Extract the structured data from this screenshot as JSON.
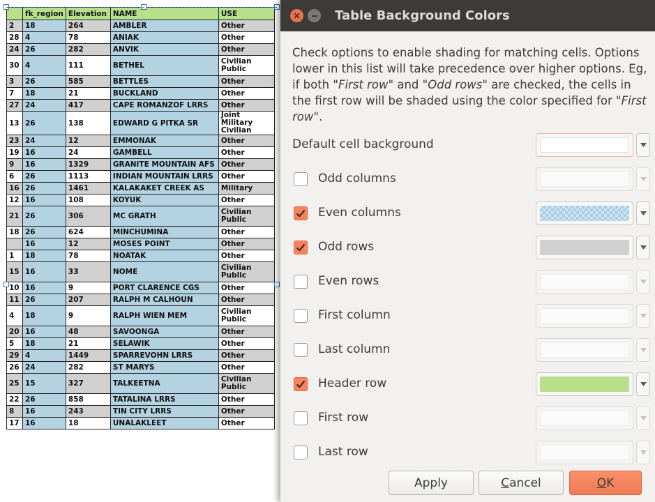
{
  "table": {
    "headers": [
      "",
      "fk_region",
      "Elevation",
      "NAME",
      "USE"
    ],
    "rows": [
      {
        "id": "2",
        "region": "18",
        "elev": "264",
        "name": "AMBLER",
        "use": "Other",
        "tall": false
      },
      {
        "id": "28",
        "region": "4",
        "elev": "78",
        "name": "ANIAK",
        "use": "Other",
        "tall": false
      },
      {
        "id": "24",
        "region": "26",
        "elev": "282",
        "name": "ANVIK",
        "use": "Other",
        "tall": false
      },
      {
        "id": "30",
        "region": "4",
        "elev": "111",
        "name": "BETHEL",
        "use": "Civilian Public",
        "tall": true
      },
      {
        "id": "3",
        "region": "26",
        "elev": "585",
        "name": "BETTLES",
        "use": "Other",
        "tall": false
      },
      {
        "id": "7",
        "region": "18",
        "elev": "21",
        "name": "BUCKLAND",
        "use": "Other",
        "tall": false
      },
      {
        "id": "27",
        "region": "24",
        "elev": "417",
        "name": "CAPE ROMANZOF LRRS",
        "use": "Other",
        "tall": false
      },
      {
        "id": "13",
        "region": "26",
        "elev": "138",
        "name": "EDWARD G PITKA SR",
        "use": "Joint Military Civilian",
        "tall": true
      },
      {
        "id": "23",
        "region": "24",
        "elev": "12",
        "name": "EMMONAK",
        "use": "Other",
        "tall": false
      },
      {
        "id": "19",
        "region": "16",
        "elev": "24",
        "name": "GAMBELL",
        "use": "Other",
        "tall": false
      },
      {
        "id": "9",
        "region": "16",
        "elev": "1329",
        "name": "GRANITE MOUNTAIN AFS",
        "use": "Other",
        "tall": false
      },
      {
        "id": "6",
        "region": "26",
        "elev": "1113",
        "name": "INDIAN MOUNTAIN LRRS",
        "use": "Other",
        "tall": false
      },
      {
        "id": "16",
        "region": "26",
        "elev": "1461",
        "name": "KALAKAKET CREEK AS",
        "use": "Military",
        "tall": false
      },
      {
        "id": "12",
        "region": "16",
        "elev": "108",
        "name": "KOYUK",
        "use": "Other",
        "tall": false
      },
      {
        "id": "21",
        "region": "26",
        "elev": "306",
        "name": "MC GRATH",
        "use": "Civilian Public",
        "tall": true
      },
      {
        "id": "18",
        "region": "26",
        "elev": "624",
        "name": "MINCHUMINA",
        "use": "Other",
        "tall": false
      },
      {
        "id": "",
        "region": "16",
        "elev": "12",
        "name": "MOSES POINT",
        "use": "Other",
        "tall": false
      },
      {
        "id": "1",
        "region": "18",
        "elev": "78",
        "name": "NOATAK",
        "use": "Other",
        "tall": false
      },
      {
        "id": "15",
        "region": "16",
        "elev": "33",
        "name": "NOME",
        "use": "Civilian Public",
        "tall": true
      },
      {
        "id": "10",
        "region": "16",
        "elev": "9",
        "name": "PORT CLARENCE CGS",
        "use": "Other",
        "tall": false
      },
      {
        "id": "11",
        "region": "26",
        "elev": "207",
        "name": "RALPH M CALHOUN",
        "use": "Other",
        "tall": false
      },
      {
        "id": "4",
        "region": "18",
        "elev": "9",
        "name": "RALPH WIEN MEM",
        "use": "Civilian Public",
        "tall": true
      },
      {
        "id": "20",
        "region": "16",
        "elev": "48",
        "name": "SAVOONGA",
        "use": "Other",
        "tall": false
      },
      {
        "id": "5",
        "region": "18",
        "elev": "21",
        "name": "SELAWIK",
        "use": "Other",
        "tall": false
      },
      {
        "id": "29",
        "region": "4",
        "elev": "1449",
        "name": "SPARREVOHN LRRS",
        "use": "Other",
        "tall": false
      },
      {
        "id": "26",
        "region": "24",
        "elev": "282",
        "name": "ST MARYS",
        "use": "Other",
        "tall": false
      },
      {
        "id": "25",
        "region": "15",
        "elev": "327",
        "name": "TALKEETNA",
        "use": "Civilian Public",
        "tall": true
      },
      {
        "id": "22",
        "region": "26",
        "elev": "858",
        "name": "TATALINA LRRS",
        "use": "Other",
        "tall": false
      },
      {
        "id": "8",
        "region": "16",
        "elev": "243",
        "name": "TIN CITY LRRS",
        "use": "Other",
        "tall": false
      },
      {
        "id": "17",
        "region": "16",
        "elev": "18",
        "name": "UNALAKLEET",
        "use": "Other",
        "tall": false
      }
    ]
  },
  "dialog": {
    "title": "Table Background Colors",
    "close_icon": "close-icon",
    "minimize_icon": "minimize-icon",
    "description": {
      "p1": "Check options to enable shading for matching cells. Options lower in this list will take precedence over higher options. Eg, if both \"",
      "em1": "First row",
      "p2": "\" and \"",
      "em2": "Odd rows",
      "p3": "\" are checked, the cells in the first row will be shaded using the color specified for \"",
      "em3": "First row",
      "p4": "\"."
    },
    "default_label": "Default cell background",
    "default_color": "#ffffff",
    "options": [
      {
        "label": "Odd columns",
        "checked": false,
        "color": "#ffffff",
        "pattern": "solid"
      },
      {
        "label": "Even columns",
        "checked": true,
        "color": "#b3d2e2",
        "pattern": "checker"
      },
      {
        "label": "Odd rows",
        "checked": true,
        "color": "#d0d0d0",
        "pattern": "solid"
      },
      {
        "label": "Even rows",
        "checked": false,
        "color": "#ffffff",
        "pattern": "solid"
      },
      {
        "label": "First column",
        "checked": false,
        "color": "#ffffff",
        "pattern": "solid"
      },
      {
        "label": "Last column",
        "checked": false,
        "color": "#ffffff",
        "pattern": "solid"
      },
      {
        "label": "Header row",
        "checked": true,
        "color": "#b7e08a",
        "pattern": "solid"
      },
      {
        "label": "First row",
        "checked": false,
        "color": "#ffffff",
        "pattern": "solid"
      },
      {
        "label": "Last row",
        "checked": false,
        "color": "#ffffff",
        "pattern": "solid"
      }
    ],
    "buttons": {
      "apply": "Apply",
      "cancel_pre": "",
      "cancel_mn": "C",
      "cancel_post": "ancel",
      "ok_mn": "O",
      "ok_post": "K"
    }
  }
}
